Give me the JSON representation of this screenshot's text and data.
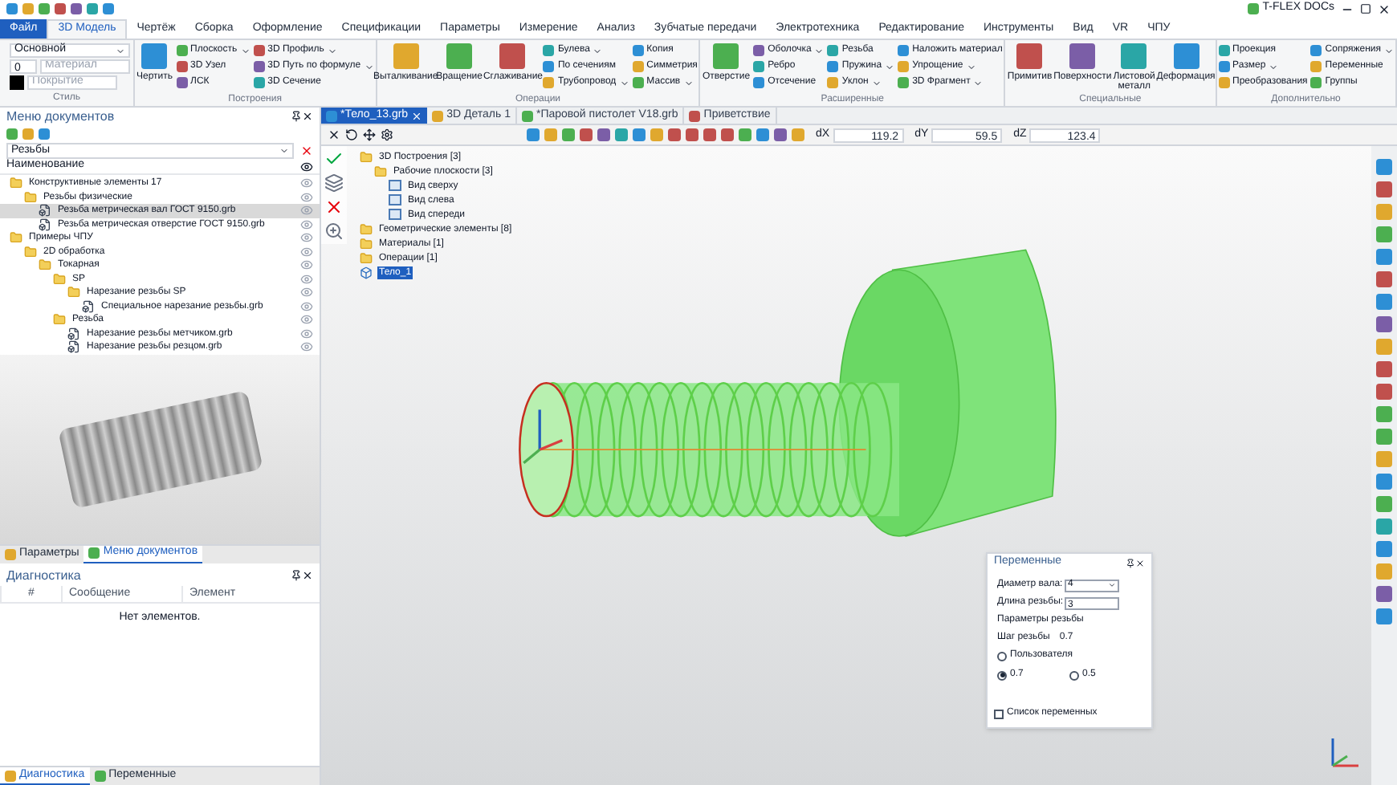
{
  "app": {
    "product": "T-FLEX DOCs"
  },
  "menu_tabs": [
    {
      "label": "Файл",
      "kind": "file",
      "selected": false
    },
    {
      "label": "3D Модель",
      "kind": "tab",
      "selected": true
    },
    {
      "label": "Чертёж",
      "kind": "tab",
      "selected": false
    },
    {
      "label": "Сборка",
      "kind": "tab",
      "selected": false
    },
    {
      "label": "Оформление",
      "kind": "tab",
      "selected": false
    },
    {
      "label": "Спецификации",
      "kind": "tab",
      "selected": false
    },
    {
      "label": "Параметры",
      "kind": "tab",
      "selected": false
    },
    {
      "label": "Измерение",
      "kind": "tab",
      "selected": false
    },
    {
      "label": "Анализ",
      "kind": "tab",
      "selected": false
    },
    {
      "label": "Зубчатые передачи",
      "kind": "tab",
      "selected": false
    },
    {
      "label": "Электротехника",
      "kind": "tab",
      "selected": false
    },
    {
      "label": "Редактирование",
      "kind": "tab",
      "selected": false
    },
    {
      "label": "Инструменты",
      "kind": "tab",
      "selected": false
    },
    {
      "label": "Вид",
      "kind": "tab",
      "selected": false
    },
    {
      "label": "VR",
      "kind": "tab",
      "selected": false
    },
    {
      "label": "ЧПУ",
      "kind": "tab",
      "selected": false
    }
  ],
  "style_group": {
    "title": "Стиль",
    "layer": "Основной",
    "level": "0",
    "material": {
      "placeholder": "Материал"
    },
    "cover": {
      "placeholder": "Покрытие"
    }
  },
  "ribbon_groups": [
    {
      "title": "Построения",
      "columns": [
        {
          "kind": "large",
          "label": "Чертить"
        },
        {
          "kind": "stack",
          "items": [
            {
              "label": "Плоскость",
              "dropdown": true
            },
            {
              "label": "3D Узел",
              "dropdown": false
            },
            {
              "label": "ЛСК",
              "dropdown": false
            }
          ]
        },
        {
          "kind": "stack",
          "items": [
            {
              "label": "3D Профиль",
              "dropdown": true
            },
            {
              "label": "3D Путь по формуле",
              "dropdown": true
            },
            {
              "label": "3D Сечение",
              "dropdown": false
            }
          ]
        }
      ]
    },
    {
      "title": "Операции",
      "columns": [
        {
          "kind": "large",
          "label": "Выталкивание"
        },
        {
          "kind": "large",
          "label": "Вращение"
        },
        {
          "kind": "large",
          "label": "Сглаживание"
        },
        {
          "kind": "stack",
          "items": [
            {
              "label": "Булева",
              "dropdown": true
            },
            {
              "label": "По сечениям",
              "dropdown": false
            },
            {
              "label": "Трубопровод",
              "dropdown": true
            }
          ]
        },
        {
          "kind": "stack",
          "items": [
            {
              "label": "Копия",
              "dropdown": false
            },
            {
              "label": "Симметрия",
              "dropdown": false
            },
            {
              "label": "Массив",
              "dropdown": true
            }
          ]
        }
      ]
    },
    {
      "title": "Расширенные",
      "columns": [
        {
          "kind": "large",
          "label": "Отверстие"
        },
        {
          "kind": "stack",
          "items": [
            {
              "label": "Оболочка",
              "dropdown": true
            },
            {
              "label": "Ребро",
              "dropdown": false
            },
            {
              "label": "Отсечение",
              "dropdown": false
            }
          ]
        },
        {
          "kind": "stack",
          "items": [
            {
              "label": "Резьба",
              "dropdown": false
            },
            {
              "label": "Пружина",
              "dropdown": true
            },
            {
              "label": "Уклон",
              "dropdown": true
            }
          ]
        },
        {
          "kind": "stack",
          "items": [
            {
              "label": "Наложить материал",
              "dropdown": false
            },
            {
              "label": "Упрощение",
              "dropdown": true
            },
            {
              "label": "3D Фрагмент",
              "dropdown": true
            }
          ]
        }
      ]
    },
    {
      "title": "Специальные",
      "columns": [
        {
          "kind": "large",
          "label": "Примитив"
        },
        {
          "kind": "large",
          "label": "Поверхности"
        },
        {
          "kind": "large",
          "label": "Листовой металл"
        },
        {
          "kind": "large",
          "label": "Деформация"
        }
      ]
    },
    {
      "title": "Дополнительно",
      "columns": [
        {
          "kind": "stack",
          "items": [
            {
              "label": "Проекция",
              "dropdown": false
            },
            {
              "label": "Размер",
              "dropdown": true
            },
            {
              "label": "Преобразования",
              "dropdown": false
            }
          ]
        },
        {
          "kind": "stack",
          "items": [
            {
              "label": "Сопряжения",
              "dropdown": true
            },
            {
              "label": "Переменные",
              "dropdown": false
            },
            {
              "label": "Группы",
              "dropdown": false
            }
          ]
        }
      ]
    }
  ],
  "documents_panel": {
    "title": "Меню документов",
    "search": {
      "value": "Резьбы"
    },
    "column": "Наименование",
    "tree": [
      {
        "label": "Конструктивные элементы 17",
        "kind": "folder",
        "selected": false,
        "children": [
          {
            "label": "Резьбы физические",
            "kind": "folder",
            "selected": false,
            "children": [
              {
                "label": "Резьба метрическая вал ГОСТ 9150.grb",
                "kind": "file",
                "selected": true
              },
              {
                "label": "Резьба метрическая отверстие ГОСТ 9150.grb",
                "kind": "file",
                "selected": false
              }
            ]
          }
        ]
      },
      {
        "label": "Примеры ЧПУ",
        "kind": "folder",
        "selected": false,
        "children": [
          {
            "label": "2D обработка",
            "kind": "folder",
            "selected": false,
            "children": [
              {
                "label": "Токарная",
                "kind": "folder",
                "selected": false,
                "children": [
                  {
                    "label": "SP",
                    "kind": "folder",
                    "selected": false,
                    "children": [
                      {
                        "label": "Нарезание резьбы SP",
                        "kind": "folder",
                        "selected": false,
                        "children": [
                          {
                            "label": "Специальное нарезание резьбы.grb",
                            "kind": "file",
                            "selected": false
                          }
                        ]
                      }
                    ]
                  },
                  {
                    "label": "Резьба",
                    "kind": "folder",
                    "selected": false,
                    "children": [
                      {
                        "label": "Нарезание резьбы метчиком.grb",
                        "kind": "file",
                        "selected": false
                      },
                      {
                        "label": "Нарезание резьбы резцом.grb",
                        "kind": "file",
                        "selected": false
                      }
                    ]
                  }
                ]
              }
            ]
          }
        ]
      }
    ],
    "tabs": [
      {
        "label": "Параметры",
        "selected": false
      },
      {
        "label": "Меню документов",
        "selected": true
      }
    ]
  },
  "diagnostics_panel": {
    "title": "Диагностика",
    "columns": [
      "#",
      "Сообщение",
      "Элемент"
    ],
    "empty_text": "Нет элементов.",
    "tabs": [
      {
        "label": "Диагностика",
        "selected": true
      },
      {
        "label": "Переменные",
        "selected": false
      }
    ]
  },
  "document_tabs": [
    {
      "label": "*Тело_13.grb",
      "selected": true,
      "closable": true
    },
    {
      "label": "3D Деталь 1",
      "selected": false,
      "closable": false
    },
    {
      "label": "*Паровой пистолет V18.grb",
      "selected": false,
      "closable": false
    },
    {
      "label": "Приветствие",
      "selected": false,
      "closable": false
    }
  ],
  "coordinates": [
    {
      "label": "dX",
      "value": "119.2"
    },
    {
      "label": "dY",
      "value": "59.5"
    },
    {
      "label": "dZ",
      "value": "123.4"
    }
  ],
  "model_tree": [
    {
      "label": "3D Построения [3]",
      "kind": "folder",
      "selected": false,
      "children": [
        {
          "label": "Рабочие плоскости [3]",
          "kind": "folder",
          "selected": false,
          "children": [
            {
              "label": "Вид сверху",
              "kind": "plane",
              "selected": false
            },
            {
              "label": "Вид слева",
              "kind": "plane",
              "selected": false
            },
            {
              "label": "Вид спереди",
              "kind": "plane",
              "selected": false
            }
          ]
        }
      ]
    },
    {
      "label": "Геометрические элементы [8]",
      "kind": "folder",
      "selected": false
    },
    {
      "label": "Материалы [1]",
      "kind": "folder",
      "selected": false
    },
    {
      "label": "Операции [1]",
      "kind": "folder",
      "selected": false
    },
    {
      "label": "Тело_1",
      "kind": "body",
      "selected": true
    }
  ],
  "variables_dialog": {
    "title": "Переменные",
    "shaft_diameter": {
      "label": "Диаметр вала:",
      "value": "4"
    },
    "thread_length": {
      "label": "Длина резьбы:",
      "value": "3"
    },
    "group_title": "Параметры резьбы",
    "pitch": {
      "label": "Шаг резьбы",
      "value": "0.7"
    },
    "options": [
      {
        "label": "Пользователя",
        "selected": false
      },
      {
        "label": "0.7",
        "selected": true
      },
      {
        "label": "0.5",
        "selected": false
      }
    ],
    "variables_list": {
      "label": "Список переменных",
      "checked": false
    }
  }
}
